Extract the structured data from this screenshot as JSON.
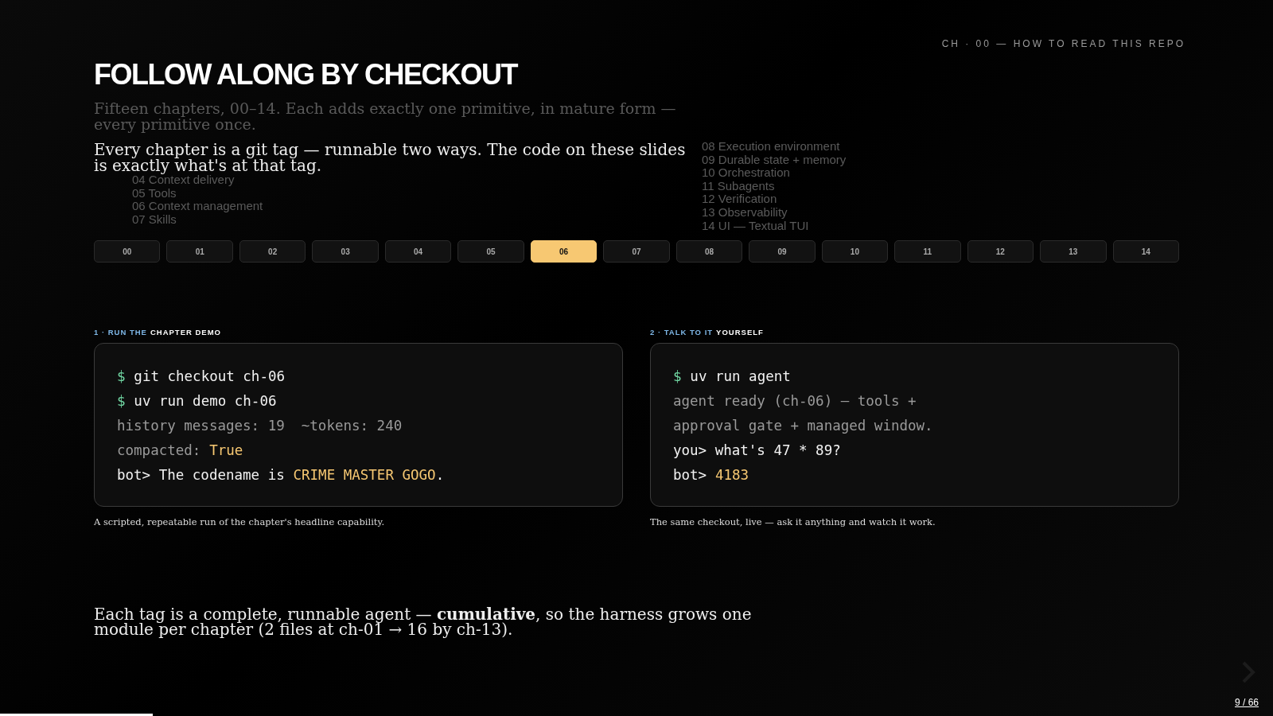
{
  "header": {
    "eyebrow": "CH · 00 — HOW TO READ THIS REPO",
    "title": "FOLLOW ALONG BY CHECKOUT"
  },
  "ghost_text": "Fifteen chapters, 00–14. Each adds exactly one primitive, in mature form — every primitive once.",
  "lead": "Every chapter is a git tag — runnable two ways. The code on these slides is exactly what's at that tag.",
  "ghost_lists": [
    [
      {
        "num": "04",
        "name": "Context delivery"
      },
      {
        "num": "05",
        "name": "Tools"
      },
      {
        "num": "06",
        "name": "Context management"
      },
      {
        "num": "07",
        "name": "Skills"
      }
    ],
    [
      {
        "num": "08",
        "name": "Execution environment"
      },
      {
        "num": "09",
        "name": "Durable state + memory"
      },
      {
        "num": "10",
        "name": "Orchestration"
      },
      {
        "num": "11",
        "name": "Subagents"
      },
      {
        "num": "12",
        "name": "Verification"
      },
      {
        "num": "13",
        "name": "Observability"
      },
      {
        "num": "14",
        "name": "UI — Textual TUI"
      }
    ]
  ],
  "tabs": [
    {
      "label": "00",
      "selected": false
    },
    {
      "label": "01",
      "selected": false
    },
    {
      "label": "02",
      "selected": false
    },
    {
      "label": "03",
      "selected": false
    },
    {
      "label": "04",
      "selected": false
    },
    {
      "label": "05",
      "selected": false
    },
    {
      "label": "06",
      "selected": true
    },
    {
      "label": "07",
      "selected": false
    },
    {
      "label": "08",
      "selected": false
    },
    {
      "label": "09",
      "selected": false
    },
    {
      "label": "10",
      "selected": false
    },
    {
      "label": "11",
      "selected": false
    },
    {
      "label": "12",
      "selected": false
    },
    {
      "label": "13",
      "selected": false
    },
    {
      "label": "14",
      "selected": false
    }
  ],
  "panels": [
    {
      "heading": [
        {
          "kind": "accent",
          "text": "1 · RUN THE"
        },
        {
          "kind": "strong",
          "text": "CHAPTER DEMO"
        }
      ],
      "lines": [
        [
          {
            "kind": "prompt",
            "text": "$"
          },
          {
            "kind": "cmd",
            "text": "git checkout ch-06"
          }
        ],
        [
          {
            "kind": "prompt",
            "text": "$"
          },
          {
            "kind": "cmd",
            "text": "uv run demo ch-06"
          }
        ],
        [
          {
            "kind": "out",
            "text": "history messages: 19  ~tokens: 240"
          }
        ],
        [
          {
            "kind": "out",
            "text": "compacted:"
          },
          {
            "kind": "hl",
            "text": "True"
          }
        ],
        [
          {
            "kind": "cmd",
            "text": "bot> The codename is"
          },
          {
            "kind": "hl",
            "text": "CRIME MASTER GOGO"
          },
          {
            "kind": "cmd",
            "text": "."
          }
        ]
      ],
      "caption": "A scripted, repeatable run of the chapter's headline capability."
    },
    {
      "heading": [
        {
          "kind": "accent",
          "text": "2 · TALK TO IT"
        },
        {
          "kind": "strong",
          "text": "YOURSELF"
        }
      ],
      "lines": [
        [
          {
            "kind": "prompt",
            "text": "$"
          },
          {
            "kind": "cmd",
            "text": "uv run agent"
          }
        ],
        [
          {
            "kind": "out",
            "text": "agent ready (ch-06) — tools +"
          }
        ],
        [
          {
            "kind": "out",
            "text": "approval gate + managed window."
          }
        ],
        [
          {
            "kind": "cmd",
            "text": "you> what's 47 * 89?"
          }
        ],
        [
          {
            "kind": "cmd",
            "text": "bot>"
          },
          {
            "kind": "hl",
            "text": "4183"
          }
        ]
      ],
      "caption": "The same checkout, live — ask it anything and watch it work."
    }
  ],
  "footer_note": "Each tag is a complete, runnable agent — **cumulative**, so the harness grows one module per chapter (2 files at ch-01 → 16 by ch-13).",
  "progress": {
    "level": 0.12
  },
  "page": "9 / 66"
}
